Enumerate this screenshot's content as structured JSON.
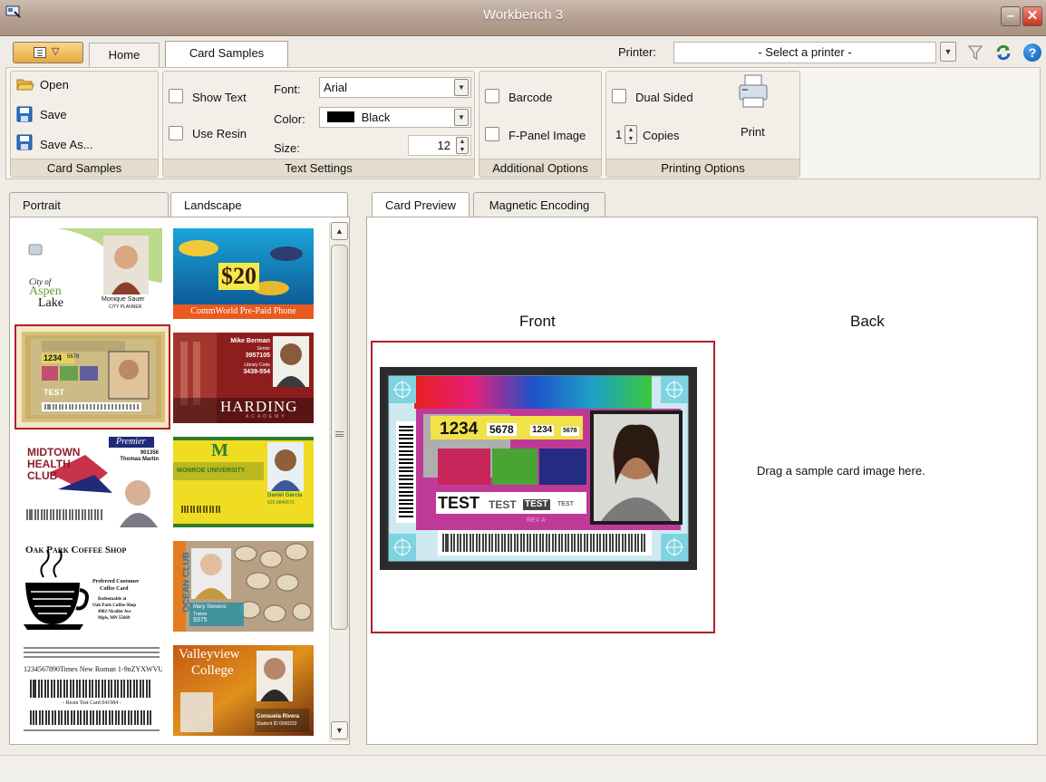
{
  "window": {
    "title": "Workbench 3"
  },
  "tabs": {
    "home": "Home",
    "card_samples": "Card Samples"
  },
  "printer": {
    "label": "Printer:",
    "selected": "- Select a printer -"
  },
  "ribbon": {
    "card_samples": {
      "open": "Open",
      "save": "Save",
      "save_as": "Save As...",
      "group_label": "Card Samples"
    },
    "text_settings": {
      "show_text": "Show Text",
      "use_resin": "Use Resin",
      "font_label": "Font:",
      "font_value": "Arial",
      "color_label": "Color:",
      "color_value": "Black",
      "color_swatch": "#000000",
      "size_label": "Size:",
      "size_value": "12",
      "group_label": "Text Settings"
    },
    "additional_options": {
      "barcode": "Barcode",
      "fpanel": "F-Panel Image",
      "group_label": "Additional Options"
    },
    "printing_options": {
      "dual_sided": "Dual Sided",
      "copies_value": "1",
      "copies_label": "Copies",
      "print": "Print",
      "group_label": "Printing Options"
    }
  },
  "left_panel": {
    "tabs": {
      "portrait": "Portrait",
      "landscape": "Landscape"
    },
    "thumbnails": {
      "aspen": {
        "city_of": "City of",
        "aspen": "Aspen",
        "lake": "Lake",
        "name": "Monique Sauer",
        "role": "CITY PLANNER"
      },
      "commworld": {
        "price": "$20",
        "caption": "CommWorld Pre-Paid Phone"
      },
      "test": {
        "num1": "1234",
        "num2": "5678",
        "test": "TEST"
      },
      "harding": {
        "name": "Mike Berman",
        "role": "Senior",
        "id": "3957105",
        "library": "Library Code",
        "code": "3439-554",
        "school": "HARDING",
        "sub": "ACADEMY"
      },
      "midtown": {
        "line1": "MIDTOWN",
        "line2": "HEALTH",
        "line3": "CLUB",
        "badge": "Premier",
        "num": "901356",
        "name": "Thomas Martin"
      },
      "monroe": {
        "letter": "M",
        "school": "MONROE UNIVERSITY",
        "name": "Daniel Garcia",
        "phone": "625-8840675"
      },
      "oakpark": {
        "title": "Oak Park Coffee Shop",
        "line1": "Preferred Customer",
        "line2": "Coffee Card",
        "line3": "Redeemable at",
        "line4": "Oak Park Coffee Shop",
        "line5": "4982 Nicollet Ave",
        "line6": "Mpls, MN 55669"
      },
      "ocean": {
        "vertical": "OCEAN CLUB",
        "name": "Mary Stevens",
        "role": "Trainer",
        "num": "9375"
      },
      "resin": {
        "sample": "1234567890Times New Roman 1-9nZYXWVU",
        "caption": "- Resin Test Card 041984 -"
      },
      "valleyview": {
        "line1": "Valleyview",
        "line2": "College",
        "name": "Consuela Rivera",
        "id": "Student ID 0000232"
      }
    }
  },
  "right_panel": {
    "tabs": {
      "card_preview": "Card Preview",
      "magnetic_encoding": "Magnetic Encoding"
    },
    "front_label": "Front",
    "back_label": "Back",
    "back_hint": "Drag a sample card image here.",
    "test_card": {
      "num1": "1234",
      "num2": "5678",
      "num3": "1234",
      "num4": "5678",
      "test1": "TEST",
      "test2": "TEST",
      "test3": "TEST",
      "test4": "TEST",
      "rev": "REV A"
    }
  }
}
